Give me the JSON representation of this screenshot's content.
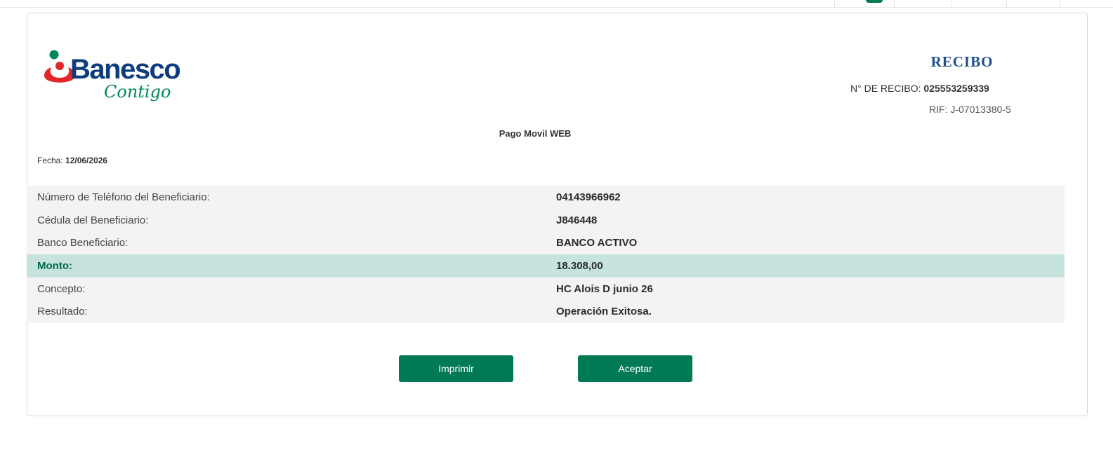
{
  "colors": {
    "brand_green": "#007a54",
    "brand_blue": "#0d3d7d",
    "brand_red": "#e3262b",
    "highlight_row": "#c7e3dd",
    "title_blue": "#1f4e8c"
  },
  "logo": {
    "brand": "Banesco",
    "tagline": "Contigo"
  },
  "header": {
    "title": "RECIBO",
    "receipt_label": "N° DE RECIBO:",
    "receipt_number": "025553259339",
    "rif": "RIF: J-07013380-5"
  },
  "operation": {
    "title": "Pago Movil WEB",
    "date_label": "Fecha:",
    "date_value": "12/06/2026"
  },
  "details": [
    {
      "label": "Número de Teléfono del Beneficiario:",
      "value": "04143966962"
    },
    {
      "label": "Cédula del Beneficiario:",
      "value": "J846448"
    },
    {
      "label": "Banco Beneficiario:",
      "value": "BANCO ACTIVO"
    },
    {
      "label": "Monto:",
      "value": "18.308,00"
    },
    {
      "label": "Concepto:",
      "value": "HC Alois D junio 26"
    },
    {
      "label": "Resultado:",
      "value": "Operación Exitosa."
    }
  ],
  "actions": {
    "print_label": "Imprimir",
    "accept_label": "Aceptar"
  }
}
